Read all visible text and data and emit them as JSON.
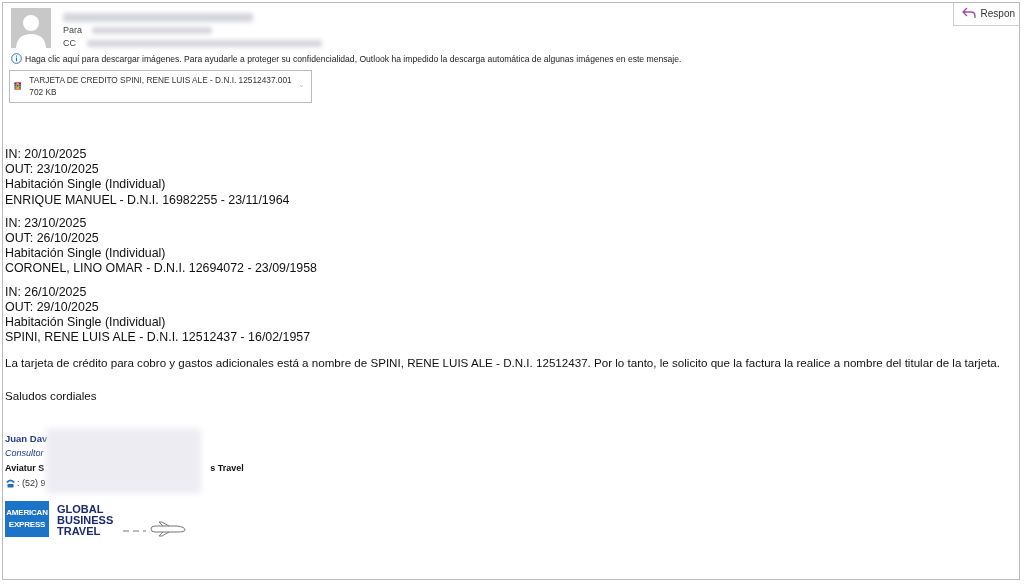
{
  "header": {
    "to_label": "Para",
    "cc_label": "CC",
    "reply_button": "Respon"
  },
  "info_bar": "Haga clic aquí para descargar imágenes. Para ayudarle a proteger su confidencialidad, Outlook ha impedido la descarga automática de algunas imágenes en este mensaje.",
  "attachment": {
    "name": "TARJETA DE CREDITO SPINI, RENE LUIS ALE - D.N.I. 12512437.001",
    "size": "702 KB"
  },
  "stays": [
    {
      "lines": [
        "IN: 20/10/2025",
        "OUT: 23/10/2025",
        "Habitación Single (Individual)",
        "ENRIQUE MANUEL - D.N.I. 16982255 - 23/11/1964"
      ]
    },
    {
      "lines": [
        "IN: 23/10/2025",
        "OUT: 26/10/2025",
        "Habitación Single (Individual)",
        "CORONEL, LINO OMAR - D.N.I. 12694072 - 23/09/1958"
      ]
    },
    {
      "lines": [
        "IN: 26/10/2025",
        "OUT: 29/10/2025",
        "Habitación Single (Individual)",
        "SPINI, RENE LUIS ALE - D.N.I. 12512437 - 16/02/1957"
      ]
    }
  ],
  "paragraphs": [
    "La tarjeta de crédito para cobro y gastos adicionales está a nombre de SPINI, RENE LUIS ALE - D.N.I. 12512437. Por lo tanto, le solicito que la factura la realice a nombre del titular de la tarjeta.",
    "Saludos cordiales"
  ],
  "signature": {
    "name": "Juan Dav",
    "role": "Consultor",
    "company_start": "Aviatur S",
    "company_end": "s Travel",
    "phone": ": (52) 9"
  },
  "logo": {
    "badge_lines": [
      "AMERICAN",
      "EXPRESS"
    ],
    "wordmark": [
      "GLOBAL",
      "BUSINESS",
      "TRAVEL"
    ]
  }
}
